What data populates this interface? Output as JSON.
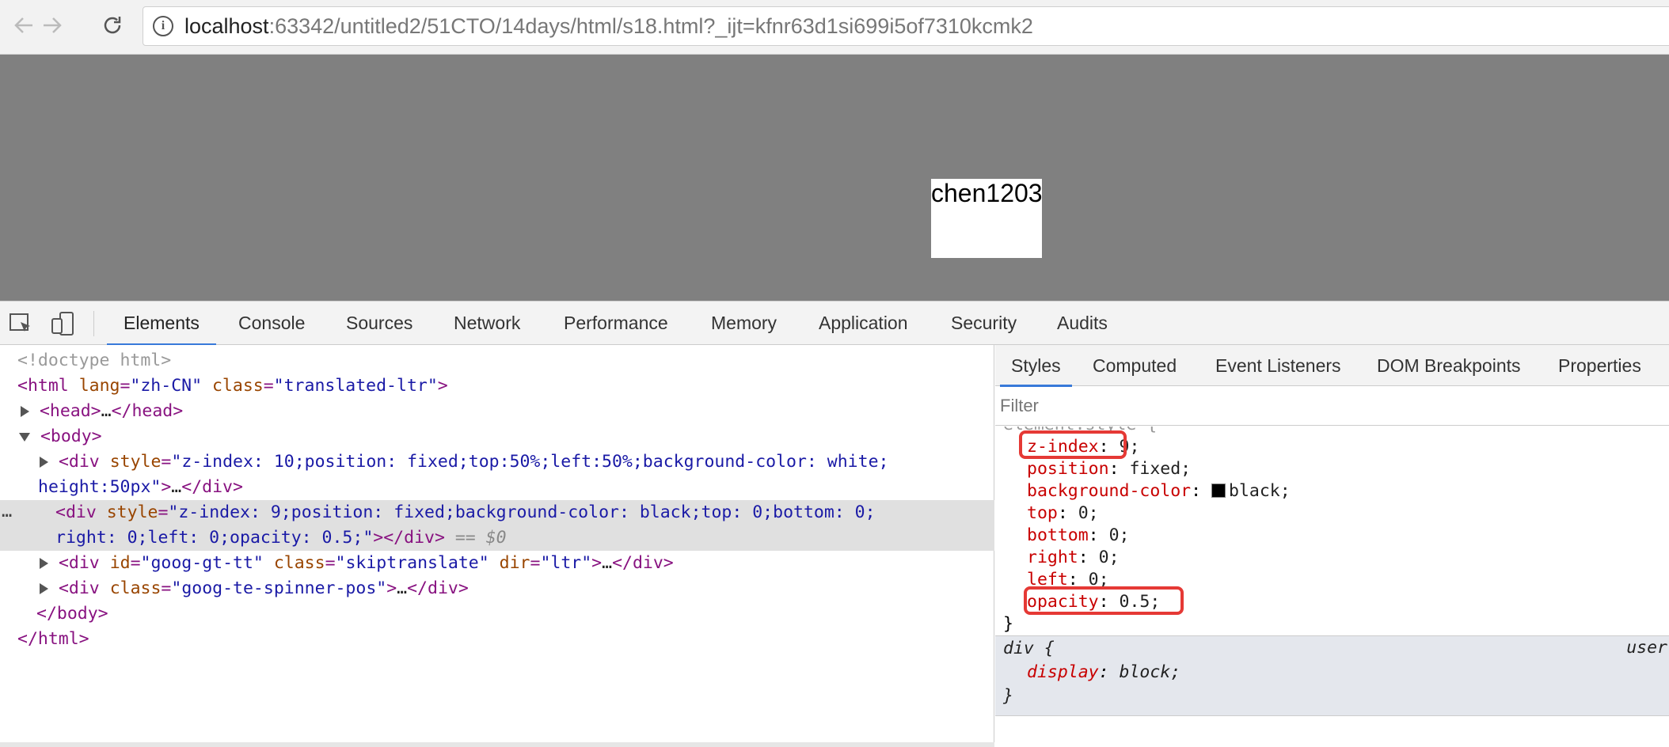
{
  "browser": {
    "url_host": "localhost",
    "url_rest": ":63342/untitled2/51CTO/14days/html/s18.html?_ijt=kfnr63d1si699i5of7310kcmk2"
  },
  "page": {
    "popup_text": "chen1203"
  },
  "devtools": {
    "tabs": [
      "Elements",
      "Console",
      "Sources",
      "Network",
      "Performance",
      "Memory",
      "Application",
      "Security",
      "Audits"
    ],
    "active_tab": "Elements"
  },
  "elements_tree": {
    "doctype": "<!doctype html>",
    "html_open_tag": "<html",
    "html_lang_attr": "lang",
    "html_lang_val": "\"zh-CN\"",
    "html_class_attr": "class",
    "html_class_val": "\"translated-ltr\"",
    "html_close_bracket": ">",
    "head": "<head>",
    "ellipsis": "…",
    "head_close": "</head>",
    "body_open": "<body>",
    "div_open": "<div",
    "style_attr": "style",
    "div1_style_a": "\"z-index: 10;position: fixed;top:50%;left:50%;background-color: white;",
    "div1_style_b": "height:50px\"",
    "div_close_bracket": ">",
    "div_close": "</div>",
    "div2_style_a": "\"z-index: 9;position: fixed;background-color: black;top: 0;bottom: 0;",
    "div2_style_b": "right: 0;left: 0;opacity: 0.5;\"",
    "selected_marker": "== $0",
    "id_attr": "id",
    "div3_id_val": "\"goog-gt-tt\"",
    "class_attr": "class",
    "div3_class_val": "\"skiptranslate\"",
    "dir_attr": "dir",
    "div3_dir_val": "\"ltr\"",
    "div4_class_val": "\"goog-te-spinner-pos\"",
    "body_close": "</body>",
    "html_close": "</html>",
    "row_ellipsis": "…"
  },
  "sidebar": {
    "tabs": [
      "Styles",
      "Computed",
      "Event Listeners",
      "DOM Breakpoints",
      "Properties"
    ],
    "active_tab": "Styles",
    "filter_placeholder": "Filter",
    "element_style_header": "element.style {",
    "declarations": [
      {
        "prop": "z-index",
        "value": "9;"
      },
      {
        "prop": "position",
        "value": "fixed;"
      },
      {
        "prop": "background-color",
        "value": "black;"
      },
      {
        "prop": "top",
        "value": "0;"
      },
      {
        "prop": "bottom",
        "value": "0;"
      },
      {
        "prop": "right",
        "value": "0;"
      },
      {
        "prop": "left",
        "value": "0;"
      },
      {
        "prop": "opacity",
        "value": "0.5;"
      }
    ],
    "close_brace": "}",
    "ua_selector": "div {",
    "ua_source": "user",
    "ua_declarations": [
      {
        "prop": "display",
        "value": "block;"
      }
    ],
    "ua_close": "}"
  },
  "colors": {
    "viewport_bg": "#808080",
    "highlight_red": "#e53935",
    "active_tab_underline": "#3879d9"
  }
}
